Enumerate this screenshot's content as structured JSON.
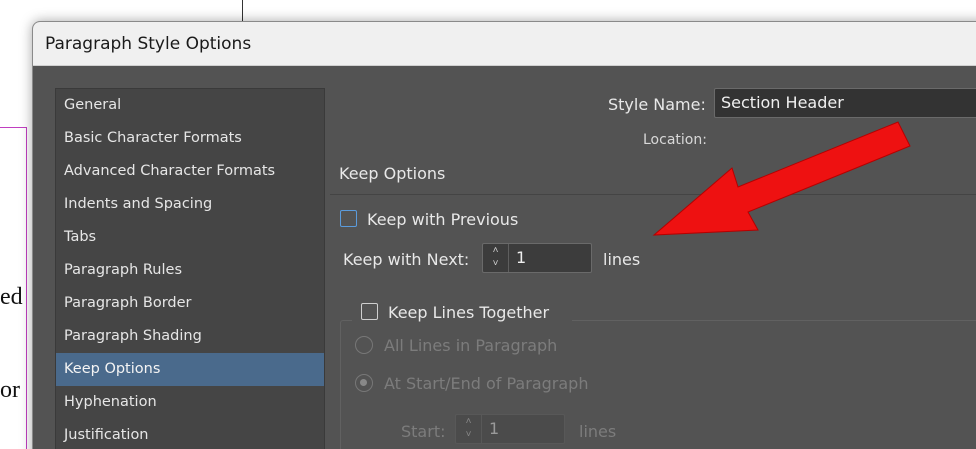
{
  "document": {
    "text_lines": [
      "ed",
      "or"
    ]
  },
  "dialog": {
    "title": "Paragraph Style Options",
    "sidebar": {
      "items": [
        {
          "label": "General",
          "active": false
        },
        {
          "label": "Basic Character Formats",
          "active": false
        },
        {
          "label": "Advanced Character Formats",
          "active": false
        },
        {
          "label": "Indents and Spacing",
          "active": false
        },
        {
          "label": "Tabs",
          "active": false
        },
        {
          "label": "Paragraph Rules",
          "active": false
        },
        {
          "label": "Paragraph Border",
          "active": false
        },
        {
          "label": "Paragraph Shading",
          "active": false
        },
        {
          "label": "Keep Options",
          "active": true
        },
        {
          "label": "Hyphenation",
          "active": false
        },
        {
          "label": "Justification",
          "active": false
        }
      ]
    },
    "style_name": {
      "label": "Style Name:",
      "value": "Section Header"
    },
    "location": {
      "label": "Location:"
    },
    "section_title": "Keep Options",
    "keep_with_previous": {
      "label": "Keep with Previous",
      "checked": false
    },
    "keep_with_next": {
      "label": "Keep with Next:",
      "value": "1",
      "unit": "lines"
    },
    "keep_lines_together": {
      "label": "Keep Lines Together",
      "checked": false
    },
    "all_lines": {
      "label": "All Lines in Paragraph",
      "selected": false
    },
    "at_start_end": {
      "label": "At Start/End of Paragraph",
      "selected": true
    },
    "start": {
      "label": "Start:",
      "value": "1",
      "unit": "lines"
    }
  },
  "annotation": {
    "color": "#ee1111",
    "icon": "red-arrow-pointer"
  }
}
